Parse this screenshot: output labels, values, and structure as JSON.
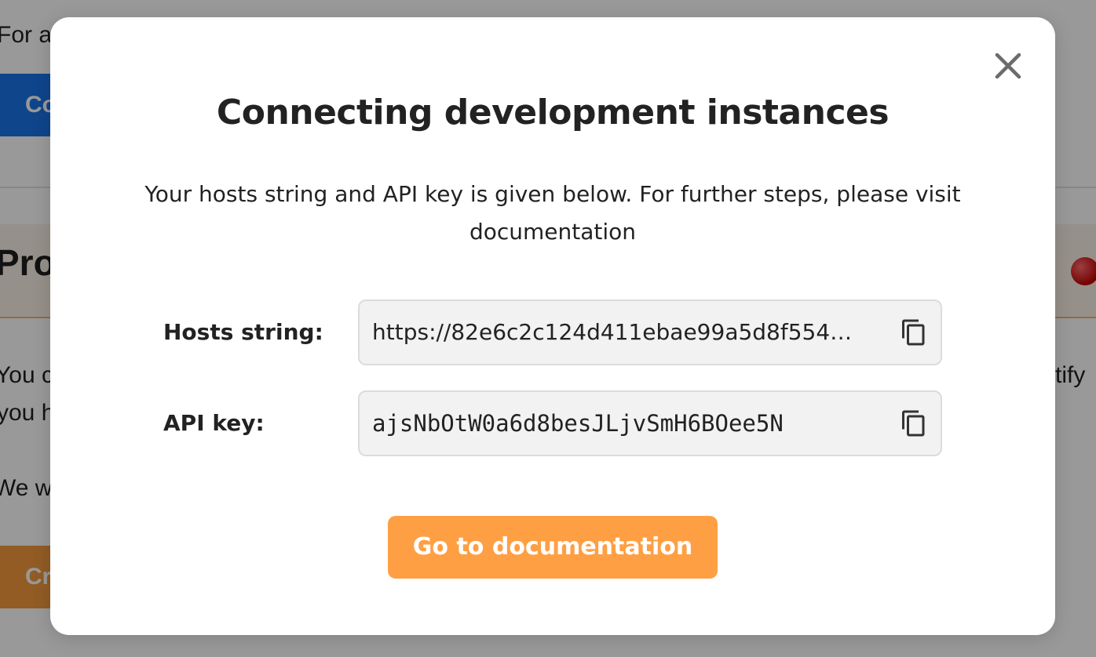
{
  "background": {
    "top_text": "For a",
    "blue_button_label": "Co",
    "banner_title": "Pro",
    "line_1": "You c",
    "line_2": "you h",
    "line_3": "We wi",
    "right_text": "tify",
    "orange_button_label": "Cr",
    "status_color": "#c40000"
  },
  "modal": {
    "title": "Connecting development instances",
    "description": "Your hosts string and API key is given below. For further steps, please visit documentation",
    "close_icon": "close-icon",
    "fields": [
      {
        "label": "Hosts string:",
        "value": "https://82e6c2c124d411ebae99a5d8f554…",
        "copy_icon": "copy-icon"
      },
      {
        "label": "API key:",
        "value": "ajsNbOtW0a6d8besJLjvSmH6BOee5N",
        "copy_icon": "copy-icon"
      }
    ],
    "primary_button_label": "Go to documentation"
  },
  "colors": {
    "accent_orange": "#ff9f43",
    "accent_blue": "#1a73e8",
    "field_background": "#f2f2f2"
  }
}
